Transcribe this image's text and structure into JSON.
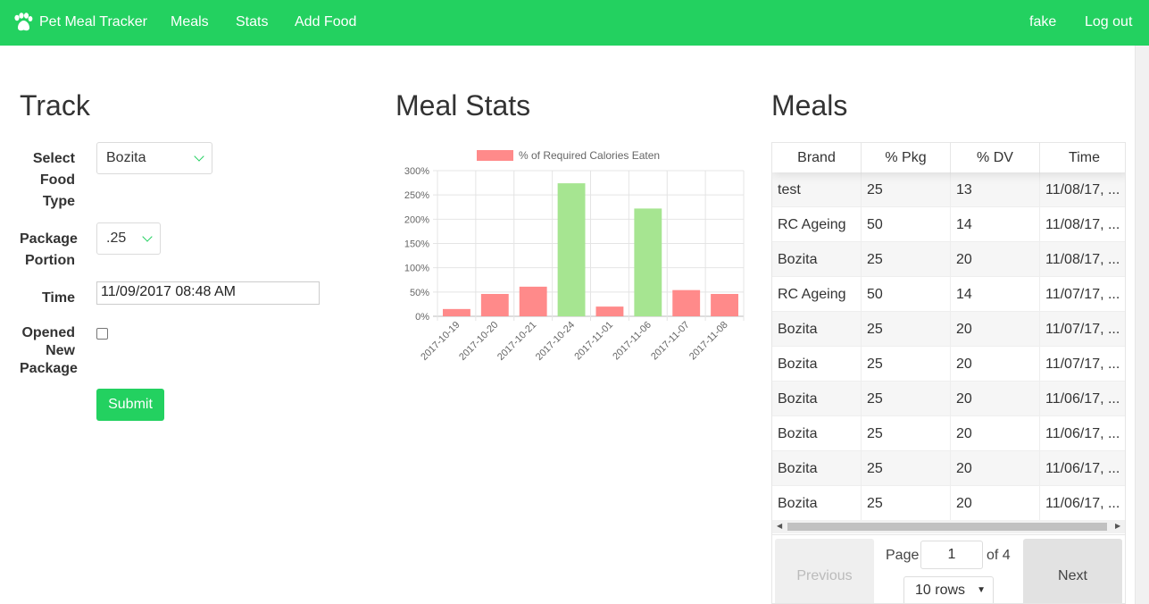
{
  "nav": {
    "brand": "Pet Meal Tracker",
    "links": [
      "Meals",
      "Stats",
      "Add Food"
    ],
    "user": "fake",
    "logout": "Log out"
  },
  "track": {
    "title": "Track",
    "food_type_label": "Select Food Type",
    "food_type_value": "Bozita",
    "portion_label": "Package Portion",
    "portion_value": ".25",
    "time_label": "Time",
    "time_value": "11/09/2017 08:48 AM",
    "opened_label": "Opened New Package",
    "opened_checked": false,
    "submit_label": "Submit"
  },
  "stats": {
    "title": "Meal Stats"
  },
  "chart_data": {
    "type": "bar",
    "categories": [
      "2017-10-19",
      "2017-10-20",
      "2017-10-21",
      "2017-10-24",
      "2017-11-01",
      "2017-11-06",
      "2017-11-07",
      "2017-11-08"
    ],
    "series": [
      {
        "name": "% of Required Calories Eaten",
        "values": [
          0.15,
          0.46,
          0.61,
          2.74,
          0.2,
          2.22,
          0.54,
          0.46
        ]
      }
    ],
    "bar_colors": [
      "#ff8a8a",
      "#ff8a8a",
      "#ff8a8a",
      "#a6e591",
      "#ff8a8a",
      "#a6e591",
      "#ff8a8a",
      "#ff8a8a"
    ],
    "ylim": [
      0,
      3
    ],
    "yticks": [
      "0%",
      "50%",
      "100%",
      "150%",
      "200%",
      "250%",
      "300%"
    ],
    "legend_position": "top",
    "grid": true
  },
  "meals": {
    "title": "Meals",
    "columns": [
      "Brand",
      "% Pkg",
      "% DV",
      "Time"
    ],
    "rows": [
      [
        "test",
        "25",
        "13",
        "11/08/17, ..."
      ],
      [
        "RC Ageing",
        "50",
        "14",
        "11/08/17, ..."
      ],
      [
        "Bozita",
        "25",
        "20",
        "11/08/17, ..."
      ],
      [
        "RC Ageing",
        "50",
        "14",
        "11/07/17, ..."
      ],
      [
        "Bozita",
        "25",
        "20",
        "11/07/17, ..."
      ],
      [
        "Bozita",
        "25",
        "20",
        "11/07/17, ..."
      ],
      [
        "Bozita",
        "25",
        "20",
        "11/06/17, ..."
      ],
      [
        "Bozita",
        "25",
        "20",
        "11/06/17, ..."
      ],
      [
        "Bozita",
        "25",
        "20",
        "11/06/17, ..."
      ],
      [
        "Bozita",
        "25",
        "20",
        "11/06/17, ..."
      ]
    ],
    "pagination": {
      "previous": "Previous",
      "next": "Next",
      "page_label": "Page",
      "page_value": "1",
      "of_label": "of 4",
      "rows_value": "10 rows"
    }
  }
}
